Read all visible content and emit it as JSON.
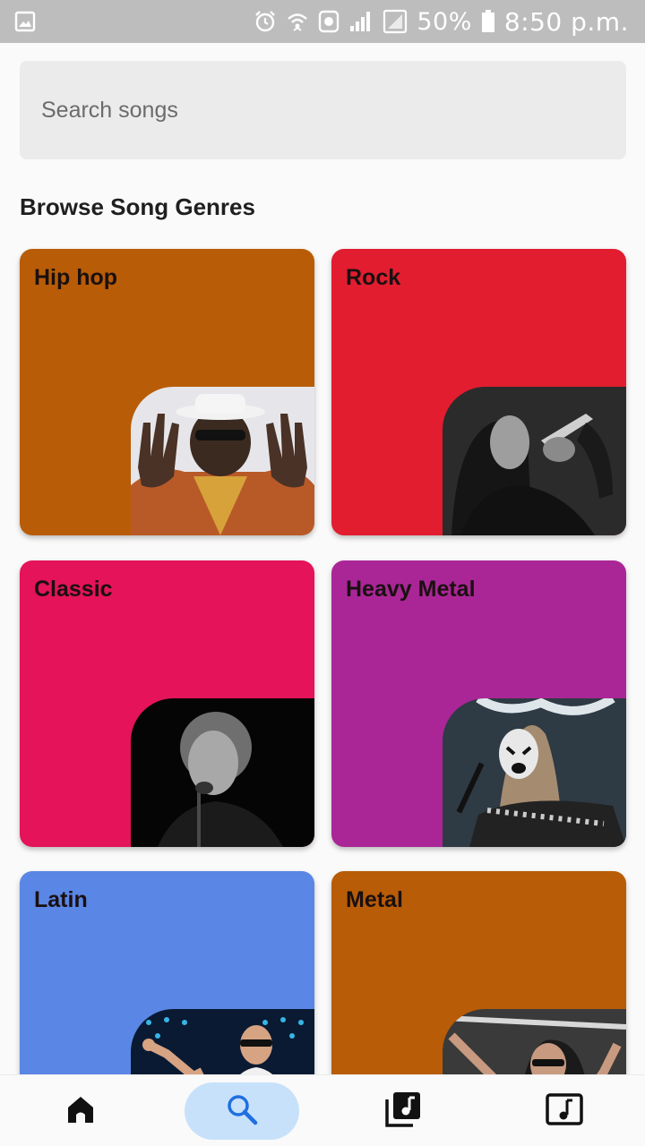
{
  "status_bar": {
    "battery": "50%",
    "time": "8:50 p.m."
  },
  "search": {
    "placeholder": "Search songs",
    "value": ""
  },
  "section_title": "Browse Song Genres",
  "genres": [
    {
      "label": "Hip hop",
      "color": "#b85c07"
    },
    {
      "label": "Rock",
      "color": "#e11d2f"
    },
    {
      "label": "Classic",
      "color": "#e4135a"
    },
    {
      "label": "Heavy Metal",
      "color": "#aa2697"
    },
    {
      "label": "Latin",
      "color": "#5a86e5"
    },
    {
      "label": "Metal",
      "color": "#b85c07"
    }
  ],
  "bottom_nav": {
    "items": [
      {
        "icon": "home-icon",
        "active": false
      },
      {
        "icon": "search-icon",
        "active": true
      },
      {
        "icon": "library-music-icon",
        "active": false
      },
      {
        "icon": "music-note-icon",
        "active": false
      }
    ],
    "active_color": "#c7e1fb"
  }
}
